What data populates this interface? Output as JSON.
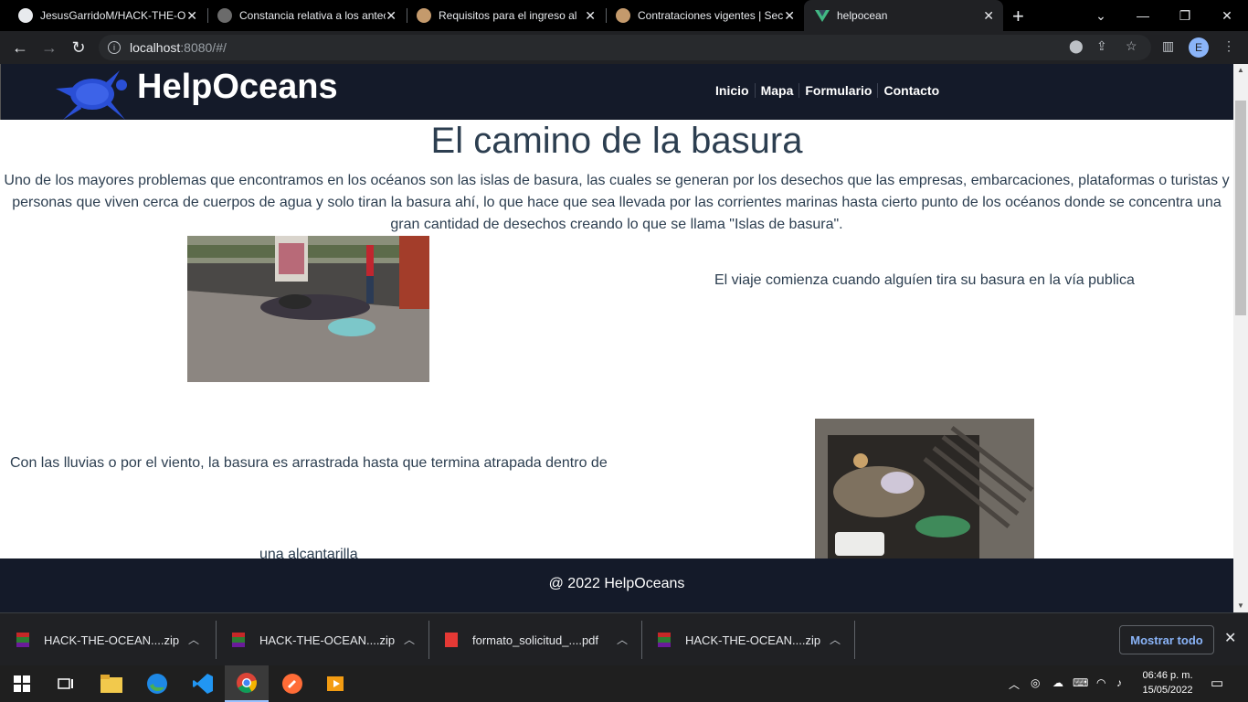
{
  "browser": {
    "tabs": [
      {
        "title": "JesusGarridoM/HACK-THE-OCEAN",
        "color": "#e8eaed"
      },
      {
        "title": "Constancia relativa a los antecedentes",
        "color": "#9aa0a6"
      },
      {
        "title": "Requisitos para el ingreso al",
        "color": "#c49a6c"
      },
      {
        "title": "Contrataciones vigentes | Secretaría",
        "color": "#c49a6c"
      },
      {
        "title": "helpocean",
        "color": "#41b883"
      }
    ],
    "url_host": "localhost",
    "url_rest": ":8080/#/",
    "profile_initial": "E"
  },
  "site": {
    "brand": "HelpOceans",
    "nav": [
      "Inicio",
      "Mapa",
      "Formulario",
      "Contacto"
    ],
    "title": "El camino de la basura",
    "intro": "Uno de los mayores problemas que encontramos en los océanos son las islas de basura, las cuales se generan por los desechos que las empresas, embarcaciones, plataformas o turistas y personas que viven cerca de cuerpos de agua y solo tiran la basura ahí, lo que hace que sea llevada por las corrientes marinas hasta cierto punto de los océanos donde se concentra una gran cantidad de desechos creando lo que se llama \"Islas de basura\".",
    "caption1": "El viaje comienza cuando alguíen tira su basura en la vía publica",
    "caption2": "Con las lluvias o por el viento, la basura es arrastrada hasta que termina atrapada dentro de",
    "caption3": "una alcantarilla",
    "footer": "@ 2022 HelpOceans"
  },
  "downloads": {
    "items": [
      "HACK-THE-OCEAN....zip",
      "HACK-THE-OCEAN....zip",
      "formato_solicitud_....pdf",
      "HACK-THE-OCEAN....zip"
    ],
    "show_all": "Mostrar todo"
  },
  "taskbar": {
    "time": "06:46 p. m.",
    "date": "15/05/2022"
  },
  "colors": {
    "header_bg": "#141a29",
    "text": "#2c3e50"
  }
}
